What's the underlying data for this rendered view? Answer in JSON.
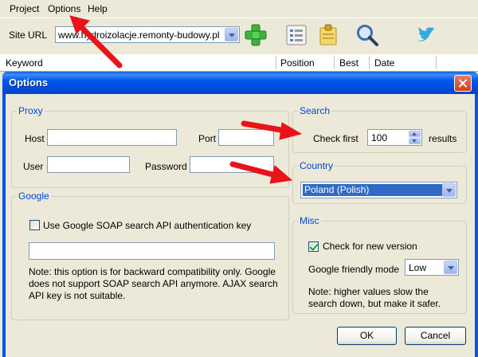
{
  "menu": {
    "items": [
      "Project",
      "Options",
      "Help"
    ]
  },
  "toolbar": {
    "site_url_label": "Site URL",
    "site_url_value": "www.hydroizolacje.remonty-budowy.pl",
    "icons": [
      "add-icon",
      "report-icon",
      "notes-icon",
      "search-icon",
      "twitter-icon"
    ]
  },
  "table": {
    "columns": [
      "Keyword",
      "Position",
      "Best",
      "Date"
    ]
  },
  "dialog": {
    "title": "Options",
    "proxy": {
      "legend": "Proxy",
      "host_label": "Host",
      "host_value": "",
      "port_label": "Port",
      "port_value": "",
      "user_label": "User",
      "user_value": "",
      "password_label": "Password",
      "password_value": ""
    },
    "google": {
      "legend": "Google",
      "soap_checkbox_label": "Use Google SOAP search API authentication key",
      "soap_checked": false,
      "key_value": "",
      "note": "Note: this option is for backward compatibility only. Google does not support SOAP search API anymore. AJAX search API key is not suitable."
    },
    "search": {
      "legend": "Search",
      "check_first_label": "Check first",
      "check_first_value": "100",
      "results_label": "results"
    },
    "country": {
      "legend": "Country",
      "selected": "Poland (Polish)"
    },
    "misc": {
      "legend": "Misc",
      "check_new_version_label": "Check for new version",
      "check_new_version_checked": true,
      "friendly_mode_label": "Google friendly mode",
      "friendly_mode_value": "Low",
      "note": "Note: higher values slow the search down, but make it safer."
    },
    "ok_label": "OK",
    "cancel_label": "Cancel"
  },
  "colors": {
    "title_bar": "#0054e3",
    "group_legend": "#0046d5",
    "annotation_arrow": "#e8141a",
    "selection": "#316ac5"
  }
}
